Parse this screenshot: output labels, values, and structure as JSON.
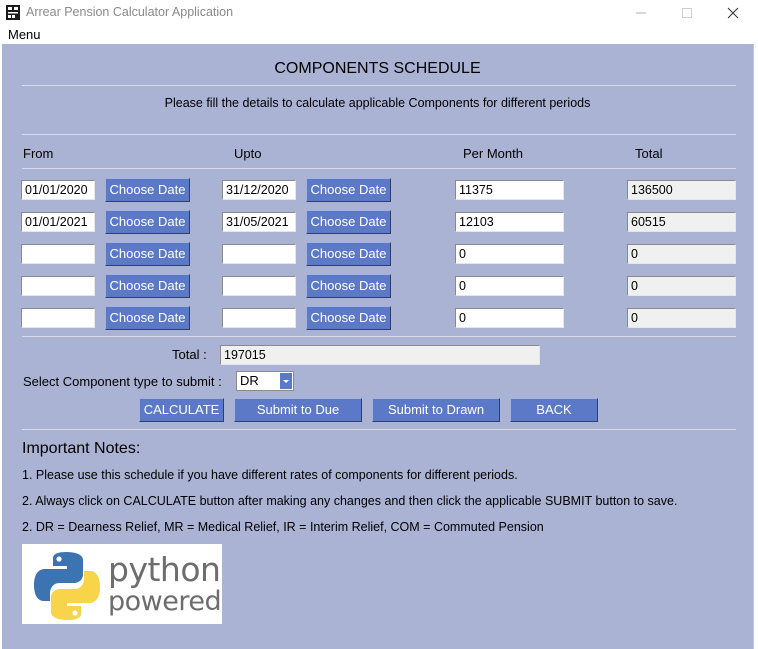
{
  "window": {
    "title": "Arrear Pension Calculator Application",
    "menu": "Menu"
  },
  "heading": "COMPONENTS SCHEDULE",
  "subtitle": "Please fill the details to calculate applicable Components for different periods",
  "columns": {
    "from": "From",
    "upto": "Upto",
    "per_month": "Per Month",
    "total": "Total"
  },
  "choose_date_label": "Choose Date",
  "rows": [
    {
      "from": "01/01/2020",
      "upto": "31/12/2020",
      "per_month": "11375",
      "total": "136500"
    },
    {
      "from": "01/01/2021",
      "upto": "31/05/2021",
      "per_month": "12103",
      "total": "60515"
    },
    {
      "from": "",
      "upto": "",
      "per_month": "0",
      "total": "0"
    },
    {
      "from": "",
      "upto": "",
      "per_month": "0",
      "total": "0"
    },
    {
      "from": "",
      "upto": "",
      "per_month": "0",
      "total": "0"
    }
  ],
  "grand_total": {
    "label": "Total :",
    "value": "197015"
  },
  "component_select": {
    "label": "Select Component type to submit :",
    "value": "DR"
  },
  "actions": {
    "calculate": "CALCULATE",
    "submit_due": "Submit to Due",
    "submit_drawn": "Submit to Drawn",
    "back": "BACK"
  },
  "notes": {
    "title": "Important Notes:",
    "items": [
      "1. Please use this schedule if you have different rates of components for different periods.",
      "2. Always click on CALCULATE button after making any changes and then click the applicable SUBMIT button to save.",
      "2. DR = Dearness Relief, MR = Medical Relief, IR = Interim Relief, COM = Commuted Pension"
    ]
  },
  "logo": {
    "line1": "python",
    "line2": "powered"
  },
  "colors": {
    "background": "#aab3d4",
    "button": "#5b79c7",
    "logo_blue": "#3b74b0",
    "logo_yellow": "#f7d44a"
  }
}
